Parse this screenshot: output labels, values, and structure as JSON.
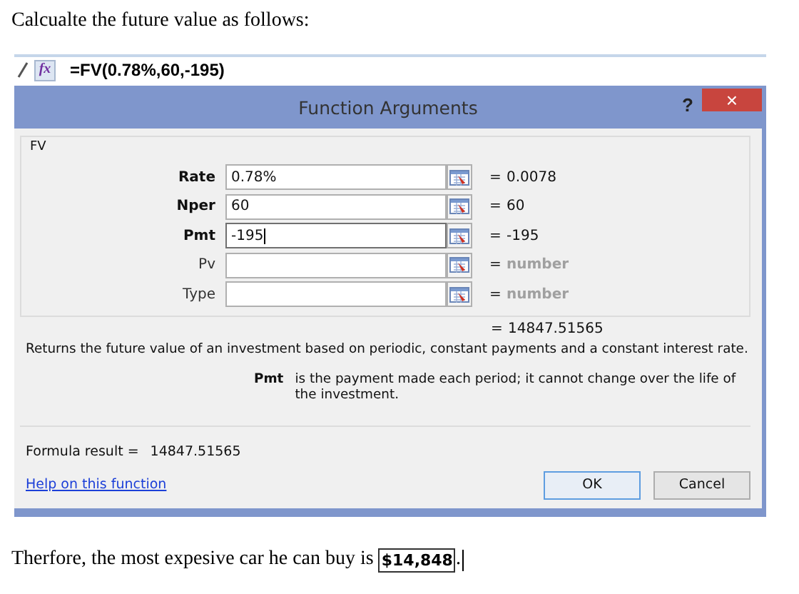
{
  "intro": "Calcualte the future value as follows:",
  "formula_bar": {
    "fx": "fx",
    "formula": "=FV(0.78%,60,-195)"
  },
  "dialog": {
    "title": "Function Arguments",
    "help_glyph": "?",
    "close_glyph": "×",
    "function_name": "FV",
    "arguments": [
      {
        "label": "Rate",
        "value": "0.78%",
        "result": "0.0078",
        "required": true,
        "focused": false
      },
      {
        "label": "Nper",
        "value": "60",
        "result": "60",
        "required": true,
        "focused": false
      },
      {
        "label": "Pmt",
        "value": "-195",
        "result": "-195",
        "required": true,
        "focused": true
      },
      {
        "label": "Pv",
        "result": "number",
        "required": false,
        "focused": false
      },
      {
        "label": "Type",
        "result": "number",
        "required": false,
        "focused": false
      }
    ],
    "equals": "=",
    "total": "14847.51565",
    "description": "Returns the future value of an investment based on periodic, constant payments and a constant interest rate.",
    "arg_name": "Pmt",
    "arg_help": "is the payment made each period; it cannot change over the life of the investment.",
    "formula_result_label": "Formula result =",
    "formula_result": "14847.51565",
    "help_link": "Help on this function",
    "buttons": [
      {
        "label": "OK",
        "default": true
      },
      {
        "label": "Cancel",
        "default": false
      }
    ]
  },
  "conclusion": "Therfore, the most expesive car he can buy is **$14,848**."
}
